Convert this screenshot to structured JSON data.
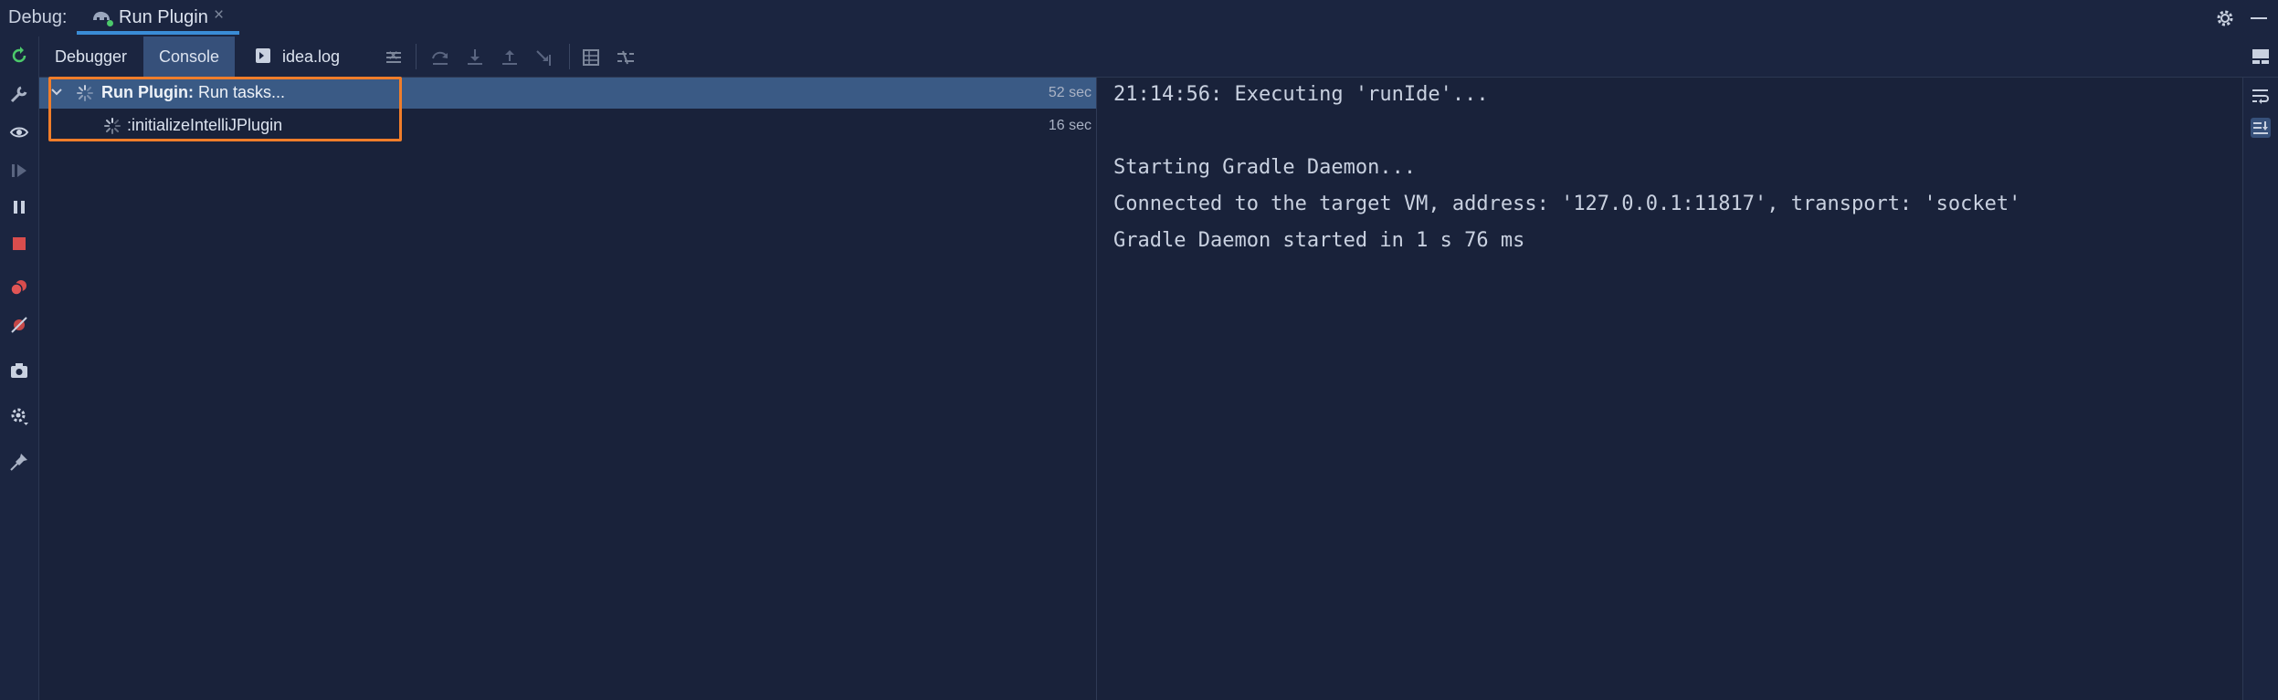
{
  "topbar": {
    "debug_label": "Debug:",
    "run_tab_title": "Run Plugin",
    "run_tab_close": "×"
  },
  "tabs": {
    "debugger": "Debugger",
    "console": "Console",
    "idea_log": "idea.log",
    "idea_log_close": "×"
  },
  "tree": {
    "root": {
      "bold": "Run Plugin:",
      "text": " Run tasks...",
      "duration": "52 sec"
    },
    "child": {
      "text": ":initializeIntelliJPlugin",
      "duration": "16 sec"
    }
  },
  "console": {
    "lines": [
      "21:14:56: Executing 'runIde'...",
      "",
      "Starting Gradle Daemon...",
      "Connected to the target VM, address: '127.0.0.1:11817', transport: 'socket'",
      "Gradle Daemon started in 1 s 76 ms"
    ]
  },
  "icons": {
    "left_toolbar": [
      "rerun-icon",
      "settings-wrench-icon",
      "watch-eye-icon",
      "resume-icon",
      "pause-icon",
      "stop-icon",
      "view-breakpoints-icon",
      "mute-breakpoints-icon",
      "camera-icon",
      "settings-icon",
      "pin-icon"
    ],
    "tab_toolbar": [
      "list-icon",
      "step-over-icon",
      "step-into-icon",
      "step-out-icon",
      "run-to-cursor-icon",
      "evaluate-icon",
      "trace-icon"
    ],
    "right_strip": [
      "layout-icon",
      "soft-wrap-icon",
      "scroll-to-end-icon"
    ]
  },
  "colors": {
    "background": "#19223a",
    "selection": "#3a5a85",
    "highlight_box": "#f07d2a",
    "active_tab": "#36507a",
    "accent": "#3a8cd6"
  }
}
